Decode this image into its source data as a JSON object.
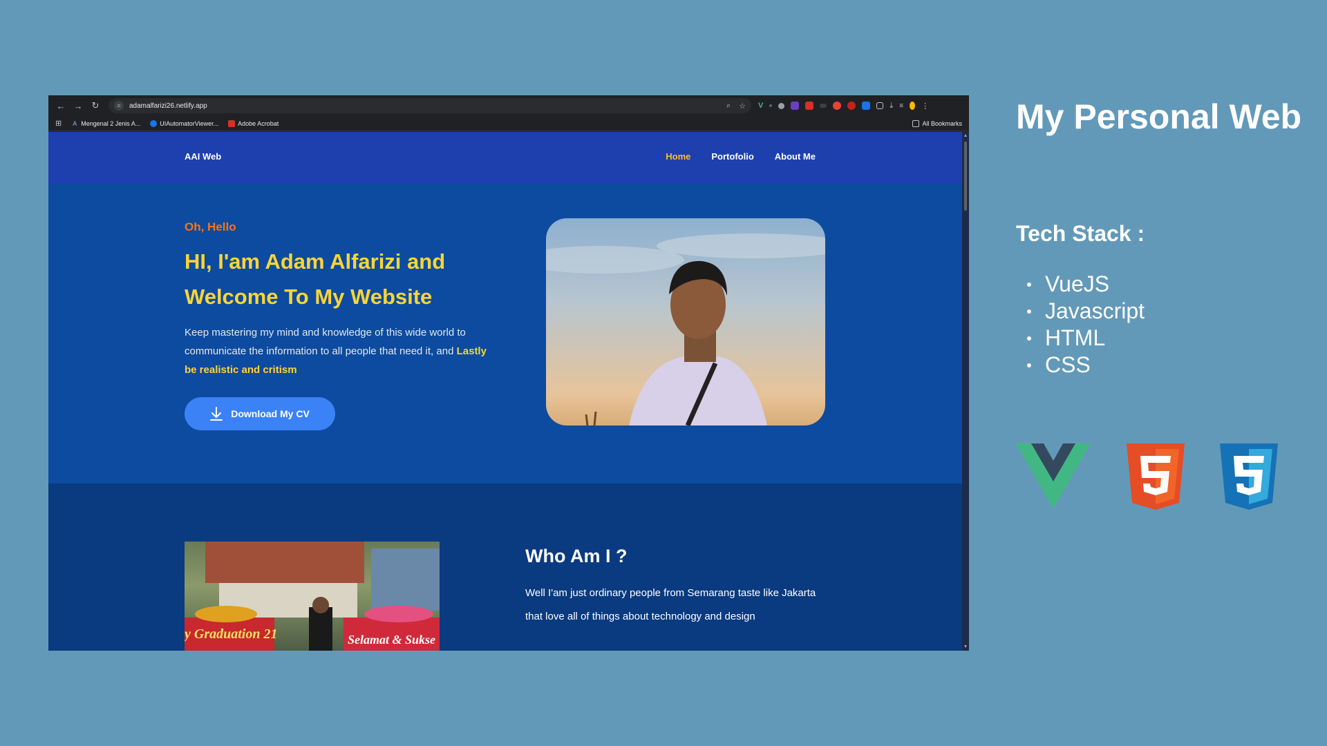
{
  "browser": {
    "url": "adamalfarizi26.netlify.app",
    "bookmarks": [
      "Mengenal 2 Jenis A...",
      "UIAutomatorViewer...",
      "Adobe Acrobat"
    ],
    "all_bookmarks": "All Bookmarks"
  },
  "site": {
    "brand": "AAI Web",
    "nav": [
      "Home",
      "Portofolio",
      "About Me"
    ],
    "active_nav": "Home",
    "hero": {
      "greeting": "Oh, Hello",
      "headline": "HI, I'am Adam Alfarizi and Welcome To My Website",
      "description_plain": "Keep mastering my mind and knowledge of this wide world to communicate the information to all people that need it, and",
      "description_bold": "Lastly be realistic and critism",
      "cta": "Download My CV"
    },
    "about": {
      "title": "Who Am I ?",
      "text": "Well I'am just ordinary people from Semarang taste like Jakarta that love all of things about technology and design",
      "banner_left": "y Graduation 21",
      "banner_right": "Selamat & Sukse"
    }
  },
  "panel": {
    "title": "My Personal Web",
    "stack_heading": "Tech Stack :",
    "stack": [
      "VueJS",
      "Javascript",
      "HTML",
      "CSS"
    ],
    "logo_colors": {
      "vue_green": "#41b883",
      "vue_dark": "#34495e",
      "html": "#e44d26",
      "css": "#1572b6"
    }
  },
  "colors": {
    "background": "#6399b8",
    "site_nav": "#1e40af",
    "hero": "#0c4ba0",
    "about": "#0a3a80",
    "accent_yellow": "#fcd534",
    "accent_orange": "#f97316",
    "button_blue": "#3b82f6"
  }
}
